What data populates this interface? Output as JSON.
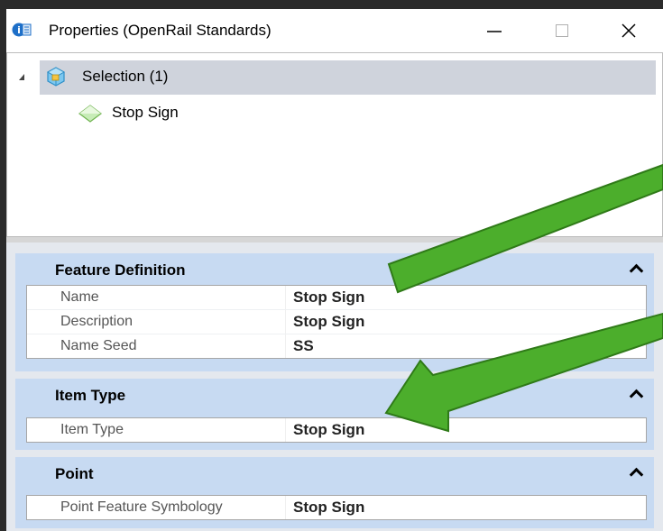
{
  "window": {
    "title": "Properties (OpenRail Standards)",
    "controls": {
      "minimize": "—",
      "maximize": "☐",
      "close": "✕"
    }
  },
  "tree": {
    "items": [
      {
        "label": "Selection (1)",
        "icon": "selection-cube-icon",
        "expanded": true,
        "selected": true
      },
      {
        "label": "Stop Sign",
        "icon": "point-feature-icon"
      }
    ]
  },
  "sections": [
    {
      "title": "Feature Definition",
      "rows": [
        {
          "name": "Name",
          "value": "Stop Sign"
        },
        {
          "name": "Description",
          "value": "Stop Sign"
        },
        {
          "name": "Name Seed",
          "value": "SS"
        }
      ]
    },
    {
      "title": "Item Type",
      "rows": [
        {
          "name": "Item Type",
          "value": "Stop Sign"
        }
      ]
    },
    {
      "title": "Point",
      "rows": [
        {
          "name": "Point Feature Symbology",
          "value": "Stop Sign"
        }
      ]
    }
  ],
  "colors": {
    "background": "#2b2b2b",
    "selection_row": "#cfd3dc",
    "section_header": "#c7daf2",
    "annotation_arrow": "#4cae2c"
  }
}
